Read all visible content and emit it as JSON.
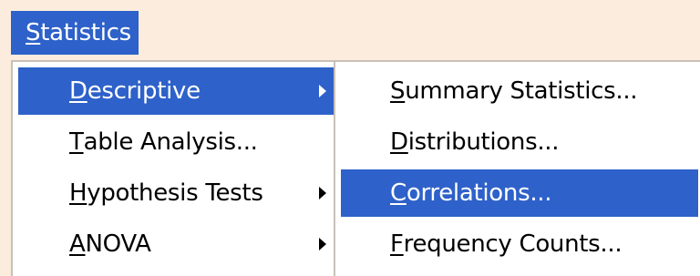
{
  "menubar": {
    "title_first": "S",
    "title_rest": "tatistics"
  },
  "menu": {
    "items": [
      {
        "first": "D",
        "rest": "escriptive",
        "has_submenu": true,
        "selected": true
      },
      {
        "first": "T",
        "rest": "able Analysis...",
        "has_submenu": false,
        "selected": false
      },
      {
        "first": "H",
        "rest": "ypothesis Tests",
        "has_submenu": true,
        "selected": false
      },
      {
        "first": "A",
        "rest": "NOVA",
        "has_submenu": true,
        "selected": false
      }
    ]
  },
  "submenu": {
    "items": [
      {
        "first": "S",
        "rest": "ummary Statistics...",
        "selected": false
      },
      {
        "first": "D",
        "rest": "istributions...",
        "selected": false
      },
      {
        "first": "C",
        "rest": "orrelations...",
        "selected": true
      },
      {
        "first": "F",
        "rest": "requency Counts...",
        "selected": false
      }
    ]
  },
  "colors": {
    "background": "#fbecdd",
    "highlight": "#2e61c9",
    "menu_bg": "#ffffff"
  }
}
